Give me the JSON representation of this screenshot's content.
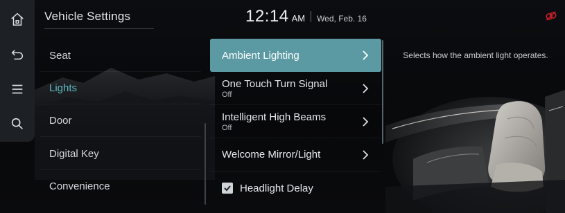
{
  "header": {
    "title": "Vehicle Settings",
    "time": "12:14",
    "ampm": "AM",
    "date": "Wed, Feb. 16"
  },
  "rail": {
    "items": [
      {
        "icon": "home-icon"
      },
      {
        "icon": "back-icon"
      },
      {
        "icon": "menu-icon"
      },
      {
        "icon": "search-icon"
      }
    ]
  },
  "status": {
    "icon": "connectivity-status-icon",
    "color": "#d8202a"
  },
  "categories": [
    {
      "label": "Seat",
      "active": false
    },
    {
      "label": "Lights",
      "active": true
    },
    {
      "label": "Door",
      "active": false
    },
    {
      "label": "Digital Key",
      "active": false
    },
    {
      "label": "Convenience",
      "active": false
    }
  ],
  "options": [
    {
      "label": "Ambient Lighting",
      "value": "",
      "type": "submenu",
      "active": true
    },
    {
      "label": "One Touch Turn Signal",
      "value": "Off",
      "type": "submenu",
      "active": false
    },
    {
      "label": "Intelligent High Beams",
      "value": "Off",
      "type": "submenu",
      "active": false
    },
    {
      "label": "Welcome Mirror/Light",
      "value": "",
      "type": "submenu",
      "active": false
    },
    {
      "label": "Headlight Delay",
      "value": "",
      "type": "checkbox",
      "checked": true
    }
  ],
  "description": "Selects how the ambient light operates.",
  "colors": {
    "accent": "#5fb9c4",
    "highlight": "#5b9aa3",
    "background": "#07080a",
    "rail": "#1d2024"
  }
}
